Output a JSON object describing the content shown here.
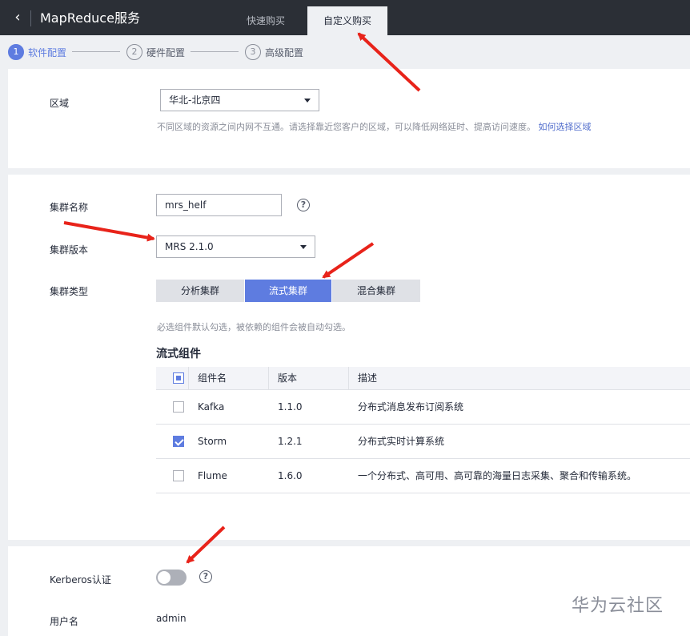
{
  "header": {
    "back_icon": "chevron-left-icon",
    "title": "MapReduce服务",
    "tabs": [
      {
        "label": "快速购买"
      },
      {
        "label": "自定义购买"
      }
    ]
  },
  "steps": [
    {
      "num": "1",
      "label": "软件配置"
    },
    {
      "num": "2",
      "label": "硬件配置"
    },
    {
      "num": "3",
      "label": "高级配置"
    }
  ],
  "region": {
    "label": "区域",
    "value": "华北-北京四",
    "hint": "不同区域的资源之间内网不互通。请选择靠近您客户的区域，可以降低网络延时、提高访问速度。",
    "hint_link": "如何选择区域"
  },
  "cluster": {
    "name_label": "集群名称",
    "name_value": "mrs_helf",
    "version_label": "集群版本",
    "version_value": "MRS 2.1.0",
    "type_label": "集群类型",
    "types": [
      "分析集群",
      "流式集群",
      "混合集群"
    ],
    "hint": "必选组件默认勾选，被依赖的组件会被自动勾选。"
  },
  "components": {
    "title": "流式组件",
    "columns": [
      "组件名",
      "版本",
      "描述"
    ],
    "rows": [
      {
        "name": "Kafka",
        "version": "1.1.0",
        "desc": "分布式消息发布订阅系统",
        "checked": false
      },
      {
        "name": "Storm",
        "version": "1.2.1",
        "desc": "分布式实时计算系统",
        "checked": true
      },
      {
        "name": "Flume",
        "version": "1.6.0",
        "desc": "一个分布式、高可用、高可靠的海量日志采集、聚合和传输系统。",
        "checked": false
      }
    ]
  },
  "security": {
    "kerberos_label": "Kerberos认证",
    "kerberos_enabled": false,
    "username_label": "用户名",
    "username_value": "admin"
  },
  "watermark": "华为云社区",
  "colors": {
    "accent": "#5e7ce0",
    "annotation": "#e8231a",
    "topbar": "#2b2f36"
  }
}
